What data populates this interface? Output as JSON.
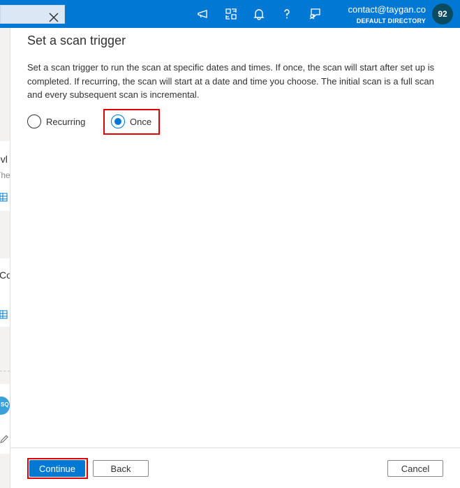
{
  "topbar": {
    "account_email": "contact@taygan.co",
    "account_directory": "DEFAULT DIRECTORY",
    "avatar_initials": "92",
    "icons": [
      "close-icon",
      "announcement-icon",
      "portal-switch-icon",
      "bell-icon",
      "help-icon",
      "feedback-icon"
    ]
  },
  "background": {
    "text_1": "ovl",
    "sub_1": "The",
    "text_2": "Co",
    "sql_badge": "SQ"
  },
  "panel": {
    "title": "Set a scan trigger",
    "description": "Set a scan trigger to run the scan at specific dates and times. If once, the scan will start after set up is completed. If recurring, the scan will start at a date and time you choose. The initial scan is a full scan and every subsequent scan is incremental.",
    "radio_options": [
      {
        "label": "Recurring",
        "checked": false
      },
      {
        "label": "Once",
        "checked": true
      }
    ]
  },
  "footer": {
    "continue_label": "Continue",
    "back_label": "Back",
    "cancel_label": "Cancel"
  },
  "colors": {
    "accent": "#0078d4",
    "highlight": "#e50000",
    "avatar_bg": "#0b4a5f"
  }
}
